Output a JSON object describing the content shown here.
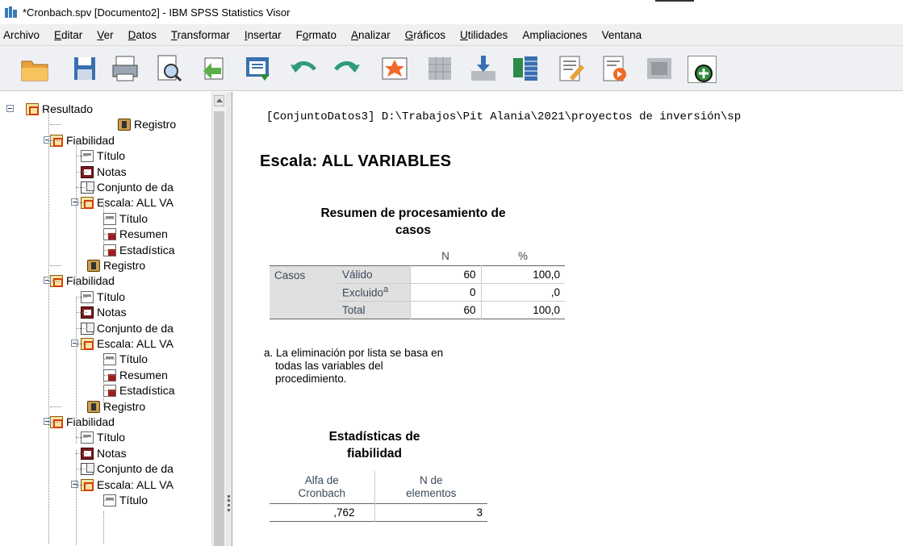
{
  "window": {
    "title": "*Cronbach.spv [Documento2] - IBM SPSS Statistics Visor"
  },
  "menu": [
    "Archivo",
    "Editar",
    "Ver",
    "Datos",
    "Transformar",
    "Insertar",
    "Formato",
    "Analizar",
    "Gráficos",
    "Utilidades",
    "Ampliaciones",
    "Ventana"
  ],
  "toolbar": [
    {
      "icon": "open-folder-icon"
    },
    {
      "icon": "save-icon"
    },
    {
      "icon": "print-icon"
    },
    {
      "icon": "print-preview-icon"
    },
    {
      "icon": "export-icon"
    },
    {
      "icon": "recall-dialog-icon"
    },
    {
      "icon": "undo-icon"
    },
    {
      "icon": "redo-icon"
    },
    {
      "icon": "goto-data-icon"
    },
    {
      "icon": "goto-case-icon"
    },
    {
      "icon": "goto-variable-icon"
    },
    {
      "icon": "variables-icon"
    },
    {
      "icon": "insert-heading-icon"
    },
    {
      "icon": "insert-title-icon"
    },
    {
      "icon": "insert-text-icon"
    },
    {
      "icon": "insert-new-icon"
    }
  ],
  "tree": [
    {
      "label": "Resultado",
      "icon": "book"
    },
    {
      "label": "Registro",
      "icon": "log"
    },
    {
      "label": "Fiabilidad",
      "icon": "book"
    },
    {
      "label": "Título",
      "icon": "title"
    },
    {
      "label": "Notas",
      "icon": "notes"
    },
    {
      "label": "Conjunto de da",
      "icon": "page"
    },
    {
      "label": "Escala: ALL VA",
      "icon": "book"
    },
    {
      "label": "Título",
      "icon": "title"
    },
    {
      "label": "Resumen",
      "icon": "table"
    },
    {
      "label": "Estadística",
      "icon": "table"
    },
    {
      "label": "Registro",
      "icon": "log"
    },
    {
      "label": "Fiabilidad",
      "icon": "book"
    },
    {
      "label": "Título",
      "icon": "title"
    },
    {
      "label": "Notas",
      "icon": "notes"
    },
    {
      "label": "Conjunto de da",
      "icon": "page"
    },
    {
      "label": "Escala: ALL VA",
      "icon": "book"
    },
    {
      "label": "Título",
      "icon": "title"
    },
    {
      "label": "Resumen",
      "icon": "table"
    },
    {
      "label": "Estadística",
      "icon": "table"
    },
    {
      "label": "Registro",
      "icon": "log"
    },
    {
      "label": "Fiabilidad",
      "icon": "book"
    },
    {
      "label": "Título",
      "icon": "title"
    },
    {
      "label": "Notas",
      "icon": "notes"
    },
    {
      "label": "Conjunto de da",
      "icon": "page"
    },
    {
      "label": "Escala: ALL VA",
      "icon": "book"
    },
    {
      "label": "Título",
      "icon": "title"
    }
  ],
  "output": {
    "path": "[ConjuntoDatos3] D:\\Trabajos\\Pit Alania\\2021\\proyectos de inversión\\sp",
    "heading": "Escala: ALL VARIABLES",
    "summary": {
      "caption1": "Resumen de procesamiento de",
      "caption2": "casos",
      "col_n": "N",
      "col_pct": "%",
      "group": "Casos",
      "rows": [
        {
          "label": "Válido",
          "sup": "",
          "n": "60",
          "pct": "100,0"
        },
        {
          "label": "Excluido",
          "sup": "a",
          "n": "0",
          "pct": ",0"
        },
        {
          "label": "Total",
          "sup": "",
          "n": "60",
          "pct": "100,0"
        }
      ],
      "footnote1": "a. La eliminación por lista se basa en",
      "footnote2": "todas las variables del",
      "footnote3": "procedimiento."
    },
    "reliability": {
      "caption1": "Estadísticas de",
      "caption2": "fiabilidad",
      "h1a": "Alfa de",
      "h1b": "Cronbach",
      "h2a": "N de",
      "h2b": "elementos",
      "alpha": ",762",
      "items": "3"
    }
  }
}
